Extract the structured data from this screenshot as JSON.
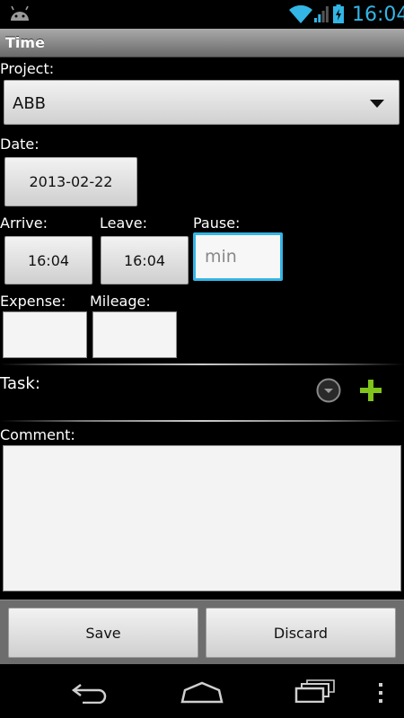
{
  "status_bar": {
    "time": "16:04",
    "icons": [
      "android-icon",
      "wifi-icon",
      "signal-icon",
      "battery-icon"
    ],
    "time_color": "#33b5e5"
  },
  "title": "Time",
  "project": {
    "label": "Project:",
    "value": "ABB"
  },
  "date": {
    "label": "Date:",
    "value": "2013-02-22"
  },
  "arrive": {
    "label": "Arrive:",
    "value": "16:04"
  },
  "leave": {
    "label": "Leave:",
    "value": "16:04"
  },
  "pause": {
    "label": "Pause:",
    "placeholder": "min",
    "value": ""
  },
  "expense": {
    "label": "Expense:",
    "value": ""
  },
  "mileage": {
    "label": "Mileage:",
    "value": ""
  },
  "task": {
    "label": "Task:",
    "icons": [
      "dropdown-circle-icon",
      "plus-icon"
    ],
    "add_color": "#7fc31c"
  },
  "comment": {
    "label": "Comment:",
    "value": ""
  },
  "actions": {
    "save_label": "Save",
    "discard_label": "Discard"
  },
  "nav": {
    "icons": [
      "back-icon",
      "home-icon",
      "recent-apps-icon",
      "overflow-menu-icon"
    ]
  },
  "colors": {
    "accent": "#33b5e5",
    "focus_border": "#33b5e5"
  }
}
